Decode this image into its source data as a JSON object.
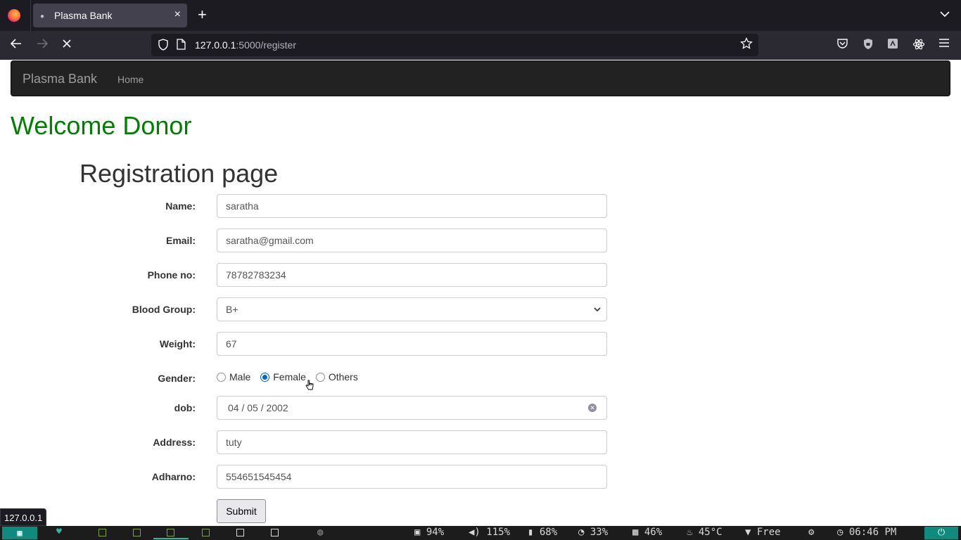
{
  "browser": {
    "tab_title": "Plasma Bank",
    "tab_close": "×",
    "new_tab": "+",
    "tab_list": "⌄",
    "url_host": "127.0.0.1",
    "url_path": ":5000/register",
    "status_url": "127.0.0.1"
  },
  "site": {
    "brand": "Plasma Bank",
    "nav_home": "Home",
    "welcome": "Welcome Donor",
    "page_title": "Registration page"
  },
  "form": {
    "name_label": "Name:",
    "name_value": "saratha",
    "email_label": "Email:",
    "email_value": "saratha@gmail.com",
    "phone_label": "Phone no:",
    "phone_value": "78782783234",
    "blood_label": "Blood Group:",
    "blood_value": "B+",
    "weight_label": "Weight:",
    "weight_value": "67",
    "gender_label": "Gender:",
    "gender_options": [
      "Male",
      "Female",
      "Others"
    ],
    "gender_selected": "Female",
    "dob_label": "dob:",
    "dob_value": "04 / 05 / 2002",
    "address_label": "Address:",
    "address_value": "tuty",
    "adhar_label": "Adharno:",
    "adhar_value": "554651545454",
    "submit_label": "Submit"
  },
  "taskbar": {
    "disk": "94%",
    "volume": "115%",
    "battery": "68%",
    "cpu": "33%",
    "memory": "46%",
    "temp": "45°C",
    "wifi": "Free",
    "time": "06:46 PM"
  },
  "colors": {
    "welcome": "#008000",
    "navbar": "#222222",
    "taskbar_accent": "#0e8a7e"
  }
}
